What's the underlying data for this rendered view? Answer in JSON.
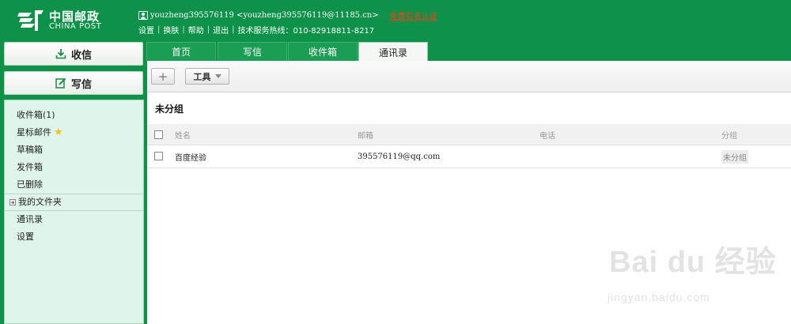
{
  "brand": {
    "name_cn": "中国邮政",
    "name_en": "CHINA POST",
    "color": "#0e9148"
  },
  "header": {
    "user_info": "youzheng395576119 <youzheng395576119@11185.cn>",
    "auth_link": "免费实名认证",
    "links": [
      "设置",
      "换肤",
      "帮助",
      "退出"
    ],
    "separator": "|",
    "hotline": "技术服务热线：010-82918811-8217"
  },
  "sidebar": {
    "receive_label": "收信",
    "compose_label": "写信",
    "folders": {
      "inbox": "收件箱(1)",
      "starred": "星标邮件",
      "drafts": "草稿箱",
      "sent": "发件箱",
      "deleted": "已删除",
      "my_folders": "我的文件夹",
      "contacts": "通讯录",
      "settings": "设置"
    }
  },
  "tabs": [
    {
      "label": "首页",
      "active": false
    },
    {
      "label": "写信",
      "active": false
    },
    {
      "label": "收件箱",
      "active": false
    },
    {
      "label": "通讯录",
      "active": true
    }
  ],
  "toolbar": {
    "add_label": "+",
    "tools_label": "工具"
  },
  "contacts": {
    "group_title": "未分组",
    "columns": {
      "name": "姓名",
      "email": "邮箱",
      "phone": "电话",
      "group": "分组"
    },
    "rows": [
      {
        "name": "百度经验",
        "email": "395576119@qq.com",
        "phone": "",
        "group": "未分组"
      }
    ]
  },
  "watermark": {
    "brand": "Bai du 经验",
    "url": "jingyan.baidu.com"
  }
}
